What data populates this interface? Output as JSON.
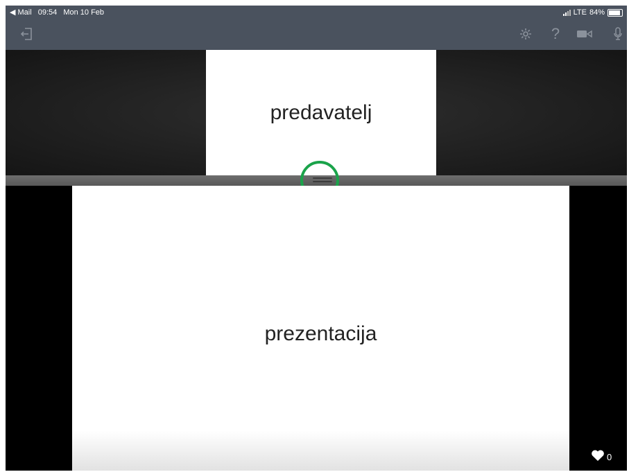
{
  "statusbar": {
    "back_label": "◀ Mail",
    "time": "09:54",
    "date": "Mon 10 Feb",
    "network": "LTE",
    "battery": "84%"
  },
  "toolbar": {
    "exit_icon": "exit-icon",
    "settings_icon": "gear-icon",
    "help_label": "?",
    "camera_icon": "video-camera-icon",
    "mic_icon": "microphone-icon"
  },
  "presenter": {
    "label": "predavatelj"
  },
  "presentation": {
    "label": "prezentacija"
  },
  "reactions": {
    "like_count": "0"
  },
  "colors": {
    "toolbar": "#4a525e",
    "icon": "#8b929c",
    "highlight_ring": "#1aa34a"
  }
}
